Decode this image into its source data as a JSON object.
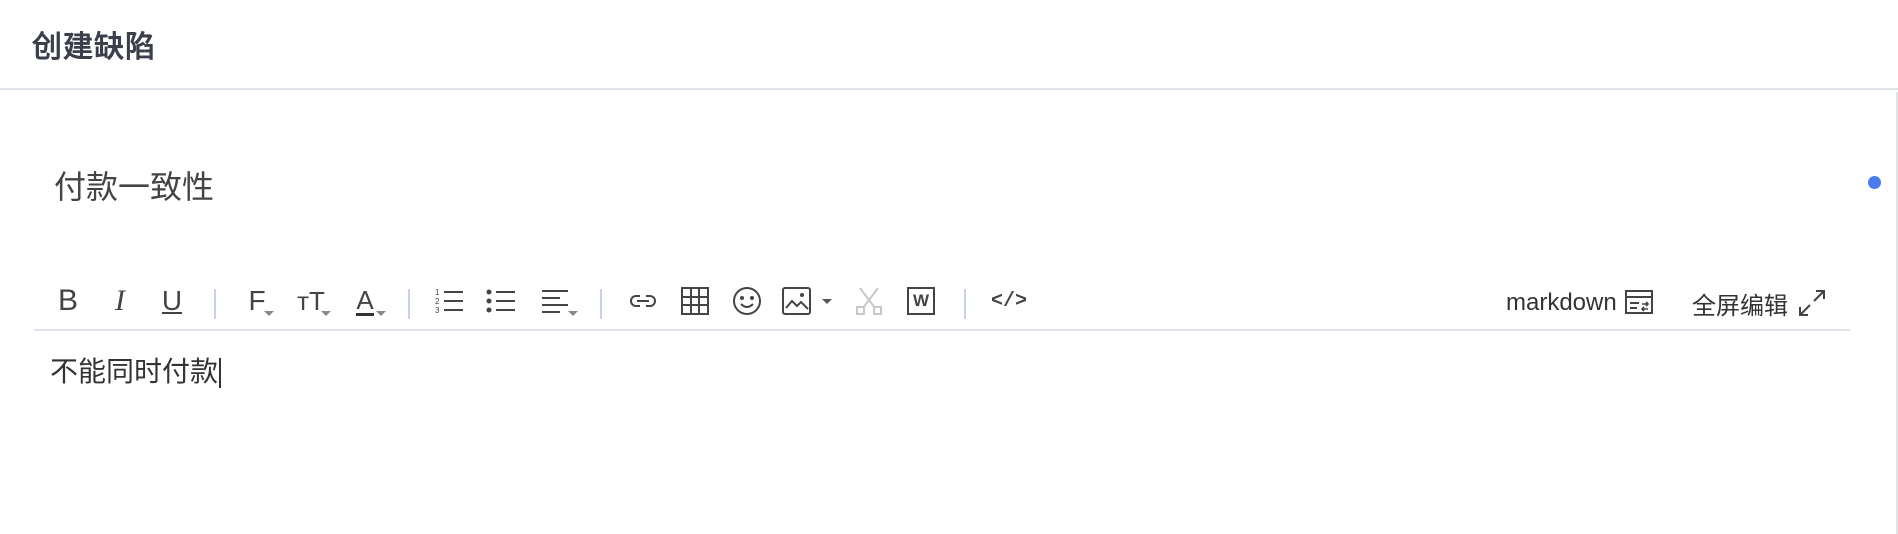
{
  "header": {
    "title": "创建缺陷"
  },
  "form": {
    "title_value": "付款一致性"
  },
  "toolbar": {
    "buttons": [
      {
        "id": "bold",
        "icon": "bold-icon",
        "glyph": "B"
      },
      {
        "id": "italic",
        "icon": "italic-icon",
        "glyph": "I"
      },
      {
        "id": "underline",
        "icon": "underline-icon",
        "glyph": "U"
      },
      {
        "id": "font-family",
        "icon": "font-family-icon",
        "glyph": "F"
      },
      {
        "id": "font-size",
        "icon": "font-size-icon",
        "glyph": "тT"
      },
      {
        "id": "font-color",
        "icon": "font-color-icon",
        "glyph": "A"
      },
      {
        "id": "ordered-list",
        "icon": "ordered-list-icon"
      },
      {
        "id": "unordered-list",
        "icon": "unordered-list-icon"
      },
      {
        "id": "align",
        "icon": "align-icon"
      },
      {
        "id": "link",
        "icon": "link-icon"
      },
      {
        "id": "table",
        "icon": "table-icon"
      },
      {
        "id": "emoji",
        "icon": "emoji-icon"
      },
      {
        "id": "image",
        "icon": "image-icon"
      },
      {
        "id": "cut",
        "icon": "scissors-icon"
      },
      {
        "id": "word",
        "icon": "word-icon",
        "glyph": "W"
      },
      {
        "id": "code",
        "icon": "code-icon",
        "glyph": "</>"
      }
    ],
    "markdown_label": "markdown",
    "fullscreen_label": "全屏编辑",
    "accent": "#4a7cf0",
    "disabled_color": "#c8c8c8"
  },
  "editor": {
    "content": "不能同时付款"
  }
}
